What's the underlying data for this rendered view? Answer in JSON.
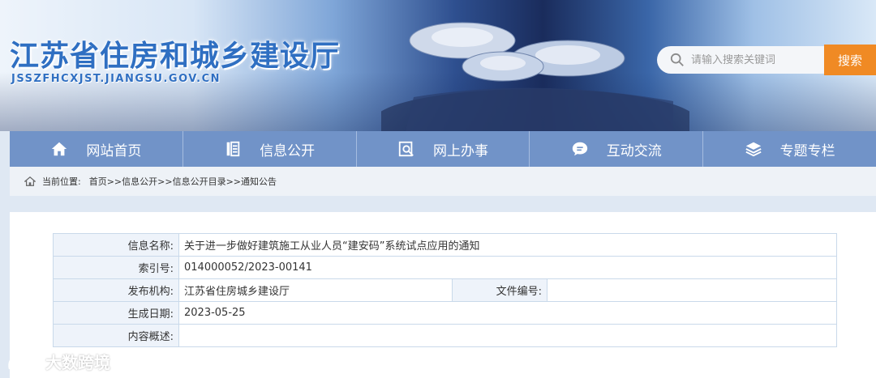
{
  "header": {
    "site_title": "江苏省住房和城乡建设厅",
    "site_domain": "JSSZFHCXJST.JIANGSU.GOV.CN",
    "search_placeholder": "请输入搜索关键词",
    "search_button": "搜索"
  },
  "nav": {
    "items": [
      {
        "label": "网站首页",
        "icon": "home-icon"
      },
      {
        "label": "信息公开",
        "icon": "list-icon"
      },
      {
        "label": "网上办事",
        "icon": "search-doc-icon"
      },
      {
        "label": "互动交流",
        "icon": "chat-icon"
      },
      {
        "label": "专题专栏",
        "icon": "layers-icon"
      }
    ]
  },
  "breadcrumb": {
    "prefix": "当前位置:",
    "items": [
      "首页",
      "信息公开",
      "信息公开目录",
      "通知公告"
    ],
    "separator": ">>"
  },
  "info": {
    "name_label": "信息名称:",
    "name_value": "关于进一步做好建筑施工从业人员“建安码”系统试点应用的通知",
    "index_label": "索引号:",
    "index_value": "014000052/2023-00141",
    "org_label": "发布机构:",
    "org_value": "江苏省住房城乡建设厅",
    "docno_label": "文件编号:",
    "docno_value": "",
    "date_label": "生成日期:",
    "date_value": "2023-05-25",
    "summary_label": "内容概述:",
    "summary_value": ""
  },
  "watermark": {
    "text": "大数跨境"
  },
  "colors": {
    "nav_bg": "#7193c8",
    "search_button": "#f08a24",
    "title_blue": "#2f6fc2"
  }
}
